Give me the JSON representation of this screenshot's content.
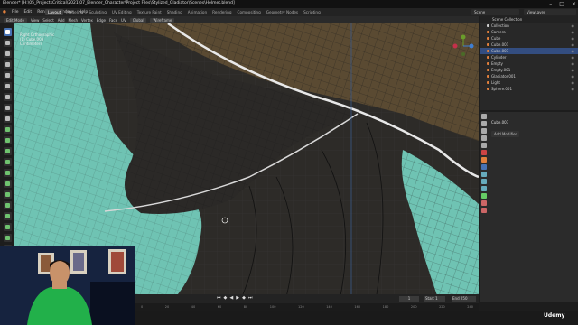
{
  "window": {
    "title": "Blender* [H:\\05_ProjectsCritical\\2021\\07_Blender_Character\\Project Files\\Stylized_Gladiator\\Scenes\\Helmet.blend]"
  },
  "menu": [
    "File",
    "Edit",
    "Render",
    "Window",
    "Help"
  ],
  "workspace_tabs": [
    "Layout",
    "Modeling",
    "Sculpting",
    "UV Editing",
    "Texture Paint",
    "Shading",
    "Animation",
    "Rendering",
    "Compositing",
    "Geometry Nodes",
    "Scripting"
  ],
  "active_tab": "Layout",
  "scene": "Scene",
  "view_layer": "ViewLayer",
  "header": {
    "mode": "Edit Mode",
    "menus": [
      "View",
      "Select",
      "Add",
      "Mesh",
      "Vertex",
      "Edge",
      "Face",
      "UV"
    ],
    "pivot": "Global",
    "shading": "Wireframe"
  },
  "viewport_info": {
    "line1": "Right Orthographic",
    "line2": "(1) Cube.003",
    "line3": "Centimeters"
  },
  "outliner": {
    "title": "Scene Collection",
    "items": [
      {
        "label": "Collection",
        "color": "#cccccc"
      },
      {
        "label": "Camera",
        "color": "#e07f3c"
      },
      {
        "label": "Cube",
        "color": "#e07f3c"
      },
      {
        "label": "Cube.001",
        "color": "#e07f3c"
      },
      {
        "label": "Cube.003",
        "color": "#e07f3c",
        "selected": true
      },
      {
        "label": "Cylinder",
        "color": "#e07f3c"
      },
      {
        "label": "Empty",
        "color": "#e07f3c"
      },
      {
        "label": "Empty.001",
        "color": "#e07f3c"
      },
      {
        "label": "Gladiator.001",
        "color": "#e07f3c"
      },
      {
        "label": "Light",
        "color": "#e07f3c"
      },
      {
        "label": "Sphere.001",
        "color": "#e07f3c"
      }
    ]
  },
  "properties": {
    "object": "Cube.003",
    "add_modifier": "Add Modifier"
  },
  "timeline": {
    "current_frame": "1",
    "start_label": "Start",
    "start": "1",
    "end_label": "End",
    "end": "250"
  },
  "ruler": [
    "0",
    "20",
    "40",
    "60",
    "80",
    "100",
    "120",
    "140",
    "160",
    "180",
    "200",
    "220",
    "240"
  ],
  "brand": "Udemy",
  "colors": {
    "accent": "#4772b3",
    "mesh_fill": "#6fc3b3",
    "selected": "#334d80"
  }
}
